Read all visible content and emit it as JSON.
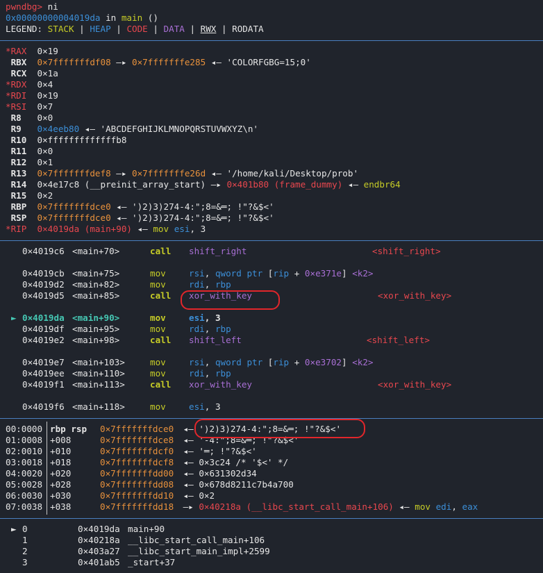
{
  "header": {
    "prompt": "pwndbg>",
    "command": " ni",
    "location_addr": "0x00000000004019da",
    "location_in": " in ",
    "location_func": "main",
    "location_args": " ()",
    "legend_label": "LEGEND: ",
    "legend_stack": "STACK",
    "legend_heap": "HEAP",
    "legend_code": "CODE",
    "legend_data": "DATA",
    "legend_rwx": "RWX",
    "legend_rodata": "RODATA",
    "legend_sep": " | "
  },
  "registers": [
    {
      "name": "*RAX",
      "changed": true,
      "parts": [
        {
          "t": "0×19",
          "c": ""
        }
      ]
    },
    {
      "name": " RBX",
      "changed": false,
      "parts": [
        {
          "t": "0×7fffffffdf08",
          "c": "orange"
        },
        {
          "t": " —▸ ",
          "c": ""
        },
        {
          "t": "0×7fffffffe285",
          "c": "orange"
        },
        {
          "t": " ◂— 'COLORFGBG=15;0'",
          "c": ""
        }
      ]
    },
    {
      "name": " RCX",
      "changed": false,
      "parts": [
        {
          "t": "0×1a",
          "c": ""
        }
      ]
    },
    {
      "name": "*RDX",
      "changed": true,
      "parts": [
        {
          "t": "0×4",
          "c": ""
        }
      ]
    },
    {
      "name": "*RDI",
      "changed": true,
      "parts": [
        {
          "t": "0×19",
          "c": ""
        }
      ]
    },
    {
      "name": "*RSI",
      "changed": true,
      "parts": [
        {
          "t": "0×7",
          "c": ""
        }
      ]
    },
    {
      "name": " R8 ",
      "changed": false,
      "parts": [
        {
          "t": "0×0",
          "c": ""
        }
      ]
    },
    {
      "name": " R9 ",
      "changed": false,
      "parts": [
        {
          "t": "0×4eeb80",
          "c": "blue"
        },
        {
          "t": " ◂— 'ABCDEFGHIJKLMNOPQRSTUVWXYZ\\n'",
          "c": ""
        }
      ]
    },
    {
      "name": " R10",
      "changed": false,
      "parts": [
        {
          "t": "0×fffffffffffffb8",
          "c": ""
        }
      ]
    },
    {
      "name": " R11",
      "changed": false,
      "parts": [
        {
          "t": "0×0",
          "c": ""
        }
      ]
    },
    {
      "name": " R12",
      "changed": false,
      "parts": [
        {
          "t": "0×1",
          "c": ""
        }
      ]
    },
    {
      "name": " R13",
      "changed": false,
      "parts": [
        {
          "t": "0×7fffffffdef8",
          "c": "orange"
        },
        {
          "t": " —▸ ",
          "c": ""
        },
        {
          "t": "0×7fffffffe26d",
          "c": "orange"
        },
        {
          "t": " ◂— '/home/kali/Desktop/prob'",
          "c": ""
        }
      ]
    },
    {
      "name": " R14",
      "changed": false,
      "parts": [
        {
          "t": "0×4e17c8 (__preinit_array_start) —▸ ",
          "c": ""
        },
        {
          "t": "0×401b80 (frame_dummy)",
          "c": "red"
        },
        {
          "t": " ◂— ",
          "c": ""
        },
        {
          "t": "endbr64",
          "c": "yellow"
        }
      ]
    },
    {
      "name": " R15",
      "changed": false,
      "parts": [
        {
          "t": "0×2",
          "c": ""
        }
      ]
    },
    {
      "name": " RBP",
      "changed": false,
      "parts": [
        {
          "t": "0×7fffffffdce0",
          "c": "orange"
        },
        {
          "t": " ◂— ')2)3)274-4:\";8=&═; !\"?&$<'",
          "c": ""
        }
      ]
    },
    {
      "name": " RSP",
      "changed": false,
      "parts": [
        {
          "t": "0×7fffffffdce0",
          "c": "orange"
        },
        {
          "t": " ◂— ')2)3)274-4:\";8=&═; !\"?&$<'",
          "c": ""
        }
      ]
    },
    {
      "name": "*RIP",
      "changed": true,
      "parts": [
        {
          "t": "0×4019da (main+90)",
          "c": "red"
        },
        {
          "t": " ◂— ",
          "c": ""
        },
        {
          "t": "mov",
          "c": "yellow"
        },
        {
          "t": " ",
          "c": ""
        },
        {
          "t": "esi",
          "c": "blue"
        },
        {
          "t": ", 3",
          "c": ""
        }
      ]
    }
  ],
  "disasm": [
    {
      "addr": "0×4019c6",
      "sym": "<main+70>",
      "op": "call",
      "args": "shift_right",
      "target": "<shift_right>",
      "current": false
    },
    {
      "addr": "0×4019cb",
      "sym": "<main+75>",
      "op": "mov",
      "args": "rsi, qword ptr [rip + 0×e371e] <k2>",
      "current": false
    },
    {
      "addr": "0×4019d2",
      "sym": "<main+82>",
      "op": "mov",
      "args": "rdi, rbp",
      "current": false
    },
    {
      "addr": "0×4019d5",
      "sym": "<main+85>",
      "op": "call",
      "args": "xor_with_key",
      "target": "<xor_with_key>",
      "current": false
    },
    {
      "addr": "0×4019da",
      "sym": "<main+90>",
      "op": "mov",
      "args": "esi, 3",
      "current": true,
      "marker": "►"
    },
    {
      "addr": "0×4019df",
      "sym": "<main+95>",
      "op": "mov",
      "args": "rdi, rbp",
      "current": false
    },
    {
      "addr": "0×4019e2",
      "sym": "<main+98>",
      "op": "call",
      "args": "shift_left",
      "target": "<shift_left>",
      "current": false
    },
    {
      "addr": "0×4019e7",
      "sym": "<main+103>",
      "op": "mov",
      "args": "rsi, qword ptr [rip + 0×e3702] <k2>",
      "current": false
    },
    {
      "addr": "0×4019ee",
      "sym": "<main+110>",
      "op": "mov",
      "args": "rdi, rbp",
      "current": false
    },
    {
      "addr": "0×4019f1",
      "sym": "<main+113>",
      "op": "call",
      "args": "xor_with_key",
      "target": "<xor_with_key>",
      "current": false
    },
    {
      "addr": "0×4019f6",
      "sym": "<main+118>",
      "op": "mov",
      "args": "esi, 3",
      "current": false
    }
  ],
  "stack": [
    {
      "idx": "00:0000",
      "off": "rbp rsp",
      "addr": "0×7fffffffdce0",
      "rest": " ◂— ')2)3)274-4:\";8=&═; !\"?&$<'"
    },
    {
      "idx": "01:0008",
      "off": "+008",
      "addr": "0×7fffffffdce8",
      "rest": " ◂— '-4:\";8=&═; !\"?&$<'"
    },
    {
      "idx": "02:0010",
      "off": "+010",
      "addr": "0×7fffffffdcf0",
      "rest": " ◂— '═; !\"?&$<'"
    },
    {
      "idx": "03:0018",
      "off": "+018",
      "addr": "0×7fffffffdcf8",
      "rest": " ◂— 0×3c24 /* '$<' */"
    },
    {
      "idx": "04:0020",
      "off": "+020",
      "addr": "0×7fffffffdd00",
      "rest": " ◂— 0×631302d34"
    },
    {
      "idx": "05:0028",
      "off": "+028",
      "addr": "0×7fffffffdd08",
      "rest": " ◂— 0×678d8211c7b4a700"
    },
    {
      "idx": "06:0030",
      "off": "+030",
      "addr": "0×7fffffffdd10",
      "rest": " ◂— 0×2"
    },
    {
      "idx": "07:0038",
      "off": "+038",
      "addr": "0×7fffffffdd18",
      "rest": " —▸ ",
      "extra_red": "0×40218a (__libc_start_call_main+106)",
      "extra_tail": " ◂— ",
      "extra_op": "mov",
      "extra_args1": " edi",
      "extra_comma": ", ",
      "extra_args2": "eax"
    }
  ],
  "backtrace": [
    {
      "marker": "►",
      "n": "0",
      "addr": "0×4019da",
      "sym": "main+90"
    },
    {
      "marker": " ",
      "n": "1",
      "addr": "0×40218a",
      "sym": "__libc_start_call_main+106"
    },
    {
      "marker": " ",
      "n": "2",
      "addr": "0×403a27",
      "sym": "__libc_start_main_impl+2599"
    },
    {
      "marker": " ",
      "n": "3",
      "addr": "0×401ab5",
      "sym": "_start+37"
    }
  ]
}
